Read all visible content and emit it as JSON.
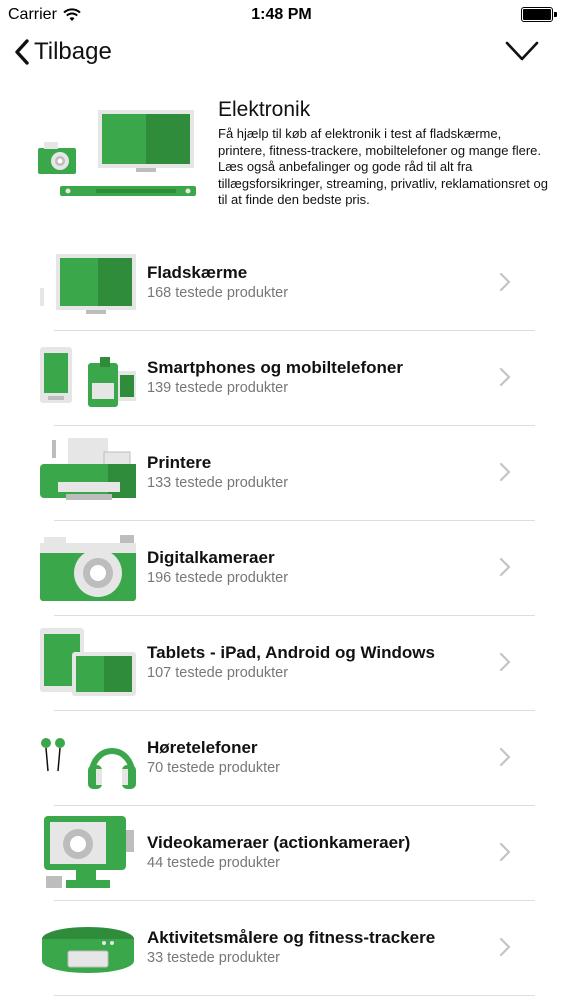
{
  "status_bar": {
    "carrier": "Carrier",
    "time": "1:48 PM"
  },
  "nav": {
    "back_label": "Tilbage"
  },
  "header": {
    "title": "Elektronik",
    "description": "Få hjælp til køb af elektronik i test af fladskærme, printere, fitness-trackere, mobiltelefoner og mange flere. Læs også anbefalinger og gode råd til alt fra tillægsforsikringer, streaming, privatliv, reklamationsret og til at finde den bedste pris."
  },
  "categories": [
    {
      "title": "Fladskærme",
      "subtitle": "168 testede produkter",
      "icon": "tv-icon"
    },
    {
      "title": "Smartphones og mobiltelefoner",
      "subtitle": "139 testede produkter",
      "icon": "smartphone-icon"
    },
    {
      "title": "Printere",
      "subtitle": "133 testede produkter",
      "icon": "printer-icon"
    },
    {
      "title": "Digitalkameraer",
      "subtitle": "196 testede produkter",
      "icon": "camera-icon"
    },
    {
      "title": "Tablets - iPad, Android og Windows",
      "subtitle": "107 testede produkter",
      "icon": "tablet-icon"
    },
    {
      "title": "Høretelefoner",
      "subtitle": "70 testede produkter",
      "icon": "headphones-icon"
    },
    {
      "title": "Videokameraer (actionkameraer)",
      "subtitle": "44 testede produkter",
      "icon": "action-camera-icon"
    },
    {
      "title": "Aktivitetsmålere og fitness-trackere",
      "subtitle": "33 testede produkter",
      "icon": "fitness-tracker-icon"
    }
  ],
  "colors": {
    "accent_green": "#3aa84a",
    "dark_green": "#2e8c3b",
    "light_gray": "#e6e6e6",
    "mid_gray": "#bdbdbd"
  }
}
